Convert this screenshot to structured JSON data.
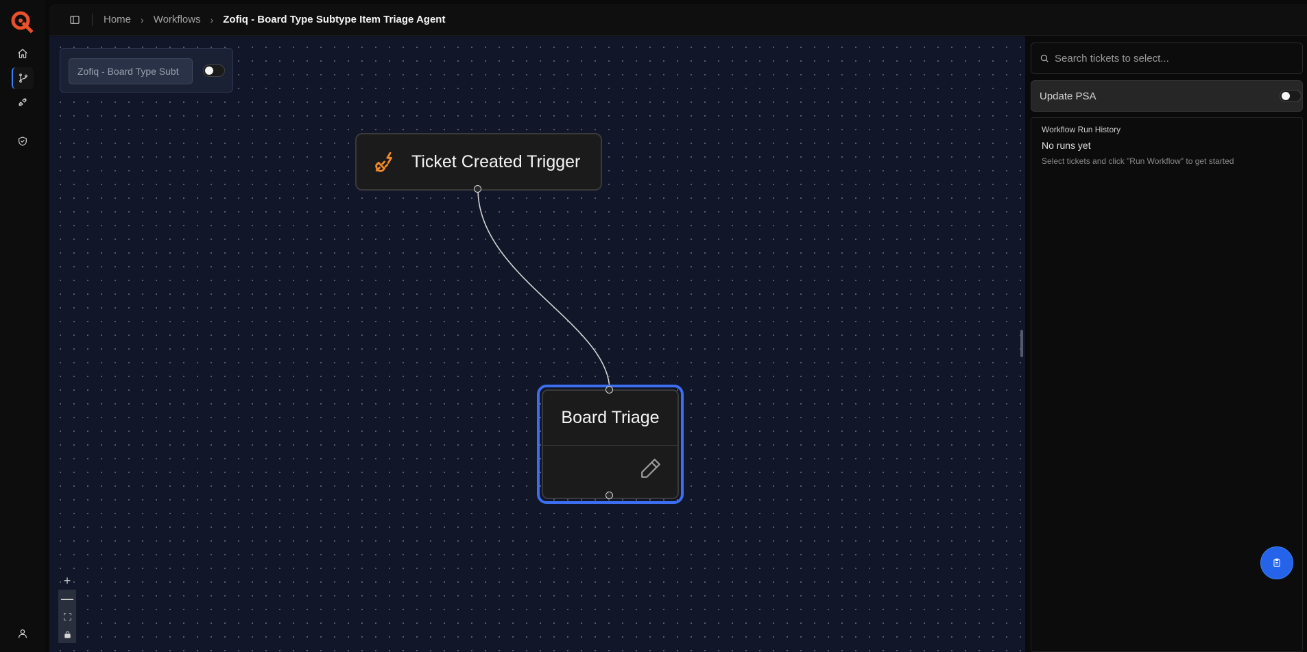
{
  "breadcrumb": {
    "home": "Home",
    "workflows": "Workflows",
    "current": "Zofiq - Board Type Subtype Item Triage Agent"
  },
  "workflow_name_input": {
    "value": "Zofiq - Board Type Subt",
    "enabled": false
  },
  "nodes": {
    "trigger": {
      "title": "Ticket Created Trigger",
      "icon": "plug-lightning-icon"
    },
    "triage": {
      "title": "Board Triage",
      "icon": "pencil-icon"
    }
  },
  "zoom_controls": {
    "zoom_in": "+",
    "zoom_out": "—"
  },
  "right_panel": {
    "search_placeholder": "Search tickets to select...",
    "update_psa": {
      "label": "Update PSA",
      "enabled": false
    },
    "history": {
      "title": "Workflow Run History",
      "empty": "No runs yet",
      "hint": "Select tickets and click \"Run Workflow\" to get started"
    }
  },
  "colors": {
    "accent": "#3b6ff0",
    "brand": "#e8512a",
    "canvas_bg": "#111629",
    "trigger_icon": "#f08a2c"
  }
}
